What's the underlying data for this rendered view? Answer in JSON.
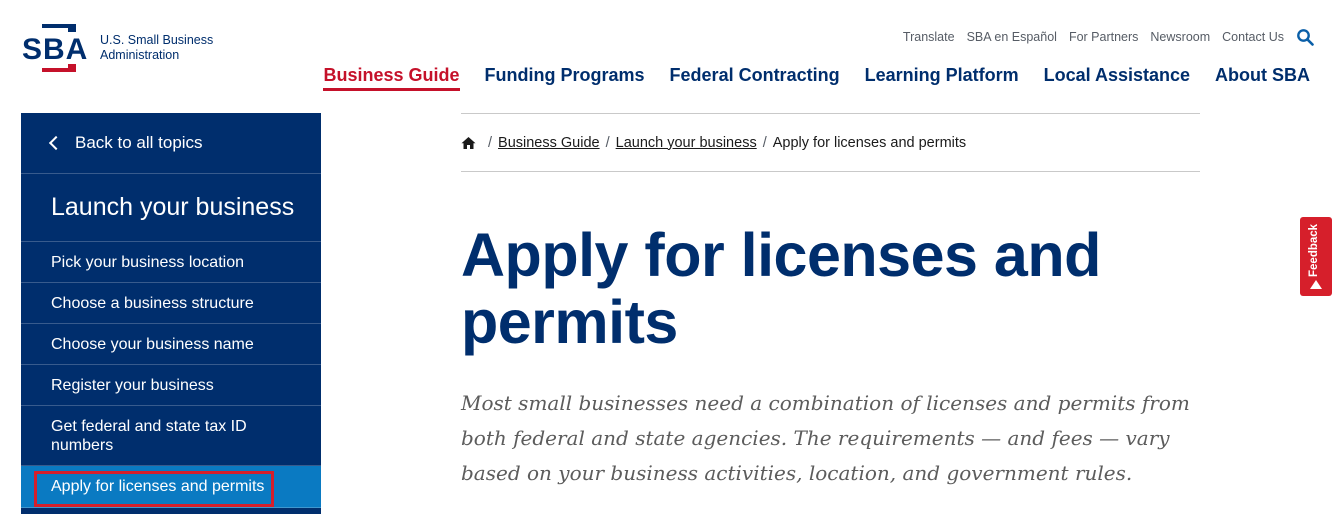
{
  "header": {
    "logo": {
      "mark": "SBA",
      "line1": "U.S. Small Business",
      "line2": "Administration"
    },
    "utility_nav": [
      "Translate",
      "SBA en Español",
      "For Partners",
      "Newsroom",
      "Contact Us"
    ],
    "search_icon": "search-icon",
    "main_nav": [
      "Business Guide",
      "Funding Programs",
      "Federal Contracting",
      "Learning Platform",
      "Local Assistance",
      "About SBA"
    ],
    "active_main_nav": "Business Guide"
  },
  "sidebar": {
    "back_label": "Back to all topics",
    "heading": "Launch your business",
    "items": [
      "Pick your business location",
      "Choose a business structure",
      "Choose your business name",
      "Register your business",
      "Get federal and state tax ID numbers",
      "Apply for licenses and permits"
    ],
    "active_item": "Apply for licenses and permits"
  },
  "breadcrumb": {
    "home_icon": "home-icon",
    "links": [
      "Business Guide",
      "Launch your business"
    ],
    "current": "Apply for licenses and permits"
  },
  "content": {
    "title": "Apply for licenses and permits",
    "intro": "Most small businesses need a combination of licenses and permits from both federal and state agencies. The requirements — and fees — vary based on your business activities, location, and government rules."
  },
  "feedback": {
    "label": "Feedback"
  },
  "colors": {
    "navy": "#002e6d",
    "red": "#c5112a",
    "active_blue": "#0a7ac2",
    "highlight_red": "#d61f2b"
  }
}
